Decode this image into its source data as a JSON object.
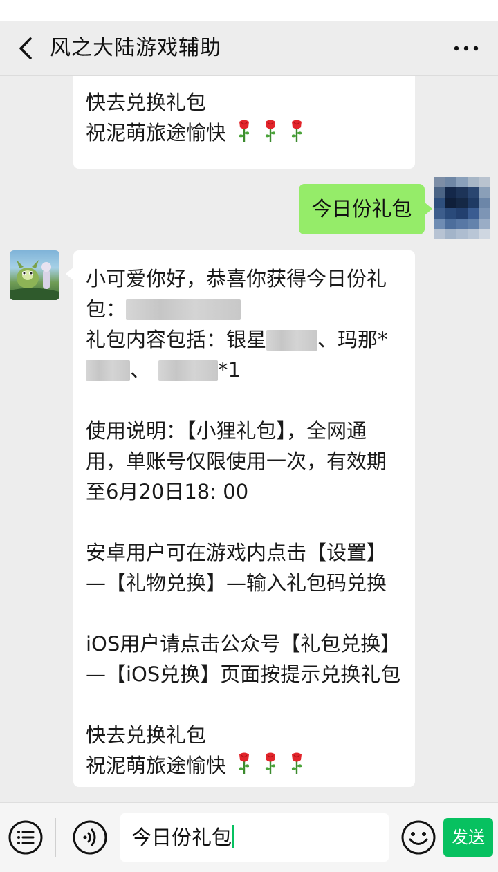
{
  "header": {
    "title": "风之大陆游戏辅助",
    "back_icon": "chevron-left-icon",
    "more_icon": "more-dots-icon"
  },
  "messages": {
    "prev_reply": {
      "line1": "快去兑换礼包",
      "line2": "祝泥萌旅途愉快"
    },
    "user_message": "今日份礼包",
    "reply": {
      "p1a": "小可爱你好，恭喜你获得今日份礼",
      "p1b": "包：",
      "p2a": "礼包内容包括：银星",
      "p2b_sep": "、玛那*",
      "p2c_sep": "、",
      "p2c_tail": "*1",
      "p3": "使用说明：【小狸礼包】，全网通用，单账号仅限使用一次，有效期至6月20日18: 00",
      "p4": "安卓用户可在游戏内点击【设置】—【礼物兑换】—输入礼包码兑换",
      "p5": "iOS用户请点击公众号【礼包兑换】—【iOS兑换】页面按提示兑换礼包",
      "p6a": "快去兑换礼包",
      "p6b": "祝泥萌旅途愉快"
    }
  },
  "input_bar": {
    "menu_icon": "menu-list-icon",
    "voice_icon": "voice-icon",
    "emoji_icon": "emoji-icon",
    "input_value": "今日份礼包",
    "send_label": "发送"
  },
  "colors": {
    "accent": "#07c160",
    "my_bubble": "#95ec69",
    "background": "#ededed"
  }
}
